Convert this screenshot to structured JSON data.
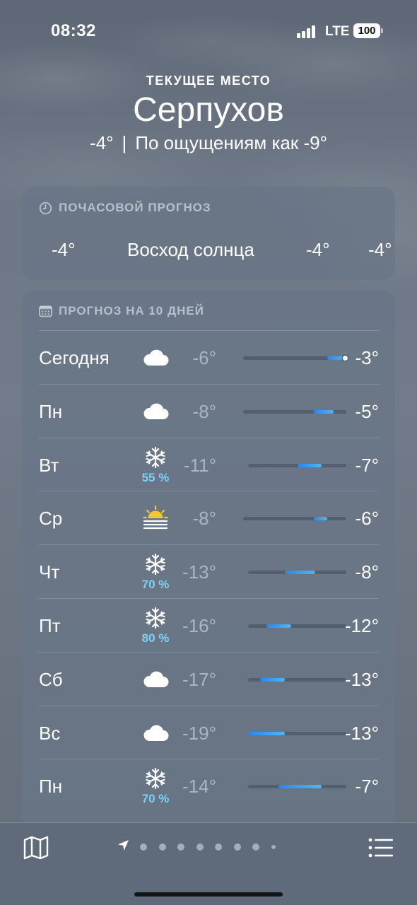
{
  "status_bar": {
    "time": "08:32",
    "network": "LTE",
    "battery": "100"
  },
  "header": {
    "location_label": "ТЕКУЩЕЕ МЕСТО",
    "city": "Серпухов",
    "current_temp": "-4°",
    "separator": "|",
    "feels_like": "По ощущениям как -9°"
  },
  "hourly": {
    "title": "ПОЧАСОВОЙ ПРОГНОЗ",
    "items": [
      "-4°",
      "Восход солнца",
      "-4°",
      "-4°"
    ]
  },
  "daily": {
    "title": "ПРОГНОЗ НА 10 ДНЕЙ",
    "days": [
      {
        "day": "Сегодня",
        "icon": "cloud-icon",
        "precip": "",
        "low": "-6°",
        "high": "-3°",
        "current_fraction": 0.94
      },
      {
        "day": "Пн",
        "icon": "cloud-icon",
        "precip": "",
        "low": "-8°",
        "high": "-5°"
      },
      {
        "day": "Вт",
        "icon": "snowflake-icon",
        "precip": "55 %",
        "low": "-11°",
        "high": "-7°"
      },
      {
        "day": "Ср",
        "icon": "sunrise-fog-icon",
        "precip": "",
        "low": "-8°",
        "high": "-6°"
      },
      {
        "day": "Чт",
        "icon": "snowflake-icon",
        "precip": "70 %",
        "low": "-13°",
        "high": "-8°"
      },
      {
        "day": "Пт",
        "icon": "snowflake-icon",
        "precip": "80 %",
        "low": "-16°",
        "high": "-12°"
      },
      {
        "day": "Сб",
        "icon": "cloud-icon",
        "precip": "",
        "low": "-17°",
        "high": "-13°"
      },
      {
        "day": "Вс",
        "icon": "cloud-icon",
        "precip": "",
        "low": "-19°",
        "high": "-13°"
      },
      {
        "day": "Пн",
        "icon": "snowflake-icon",
        "precip": "70 %",
        "low": "-14°",
        "high": "-7°"
      }
    ]
  },
  "bottom_bar": {
    "pages": 9,
    "active_page": "location-arrow-icon"
  },
  "colors": {
    "precip": "#7ed0f7",
    "bar_start": "#2c86f0",
    "bar_end": "#4db6f2"
  }
}
